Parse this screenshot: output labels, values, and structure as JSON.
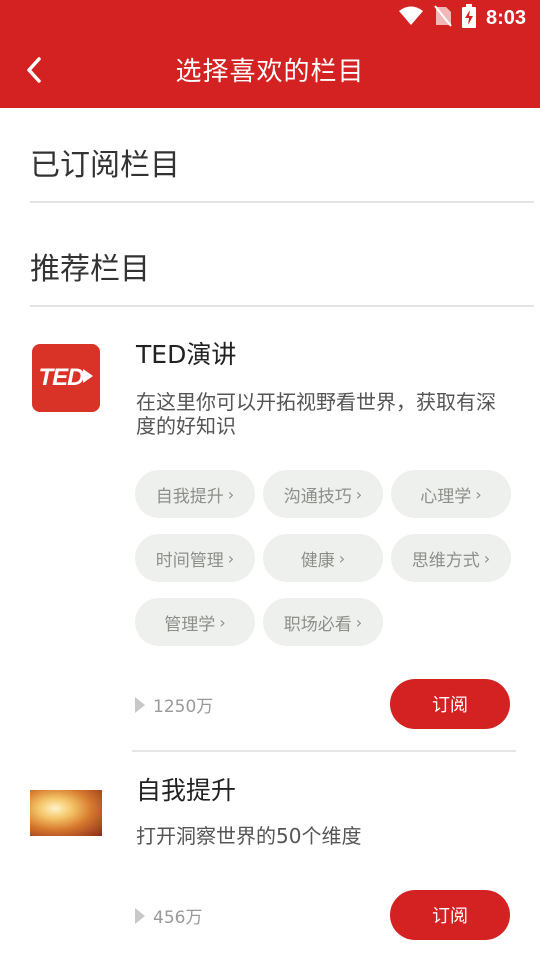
{
  "status_bar": {
    "time": "8:03",
    "icons": [
      "wifi-icon",
      "no-sim-icon",
      "battery-charging-icon"
    ]
  },
  "app_bar": {
    "back_icon": "chevron-left-icon",
    "title": "选择喜欢的栏目"
  },
  "sections": {
    "subscribed_title": "已订阅栏目",
    "recommended_title": "推荐栏目"
  },
  "channels": [
    {
      "name": "TED演讲",
      "icon": "ted-logo-icon",
      "icon_text": "TED",
      "icon_color": "#d93226",
      "description": "在这里你可以开拓视野看世界，获取有深度的好知识",
      "tags": [
        "自我提升",
        "沟通技巧",
        "心理学",
        "时间管理",
        "健康",
        "思维方式",
        "管理学",
        "职场必看"
      ],
      "count": "1250万",
      "subscribe_label": "订阅"
    },
    {
      "name": "自我提升",
      "icon": "sunlit-photo-thumbnail",
      "description": "打开洞察世界的50个维度",
      "count": "456万",
      "subscribe_label": "订阅"
    }
  ],
  "colors": {
    "primary": "#d42222",
    "tag_bg": "#eef0ed",
    "tag_text": "#8c8f8a",
    "divider": "#e5e5e5"
  }
}
